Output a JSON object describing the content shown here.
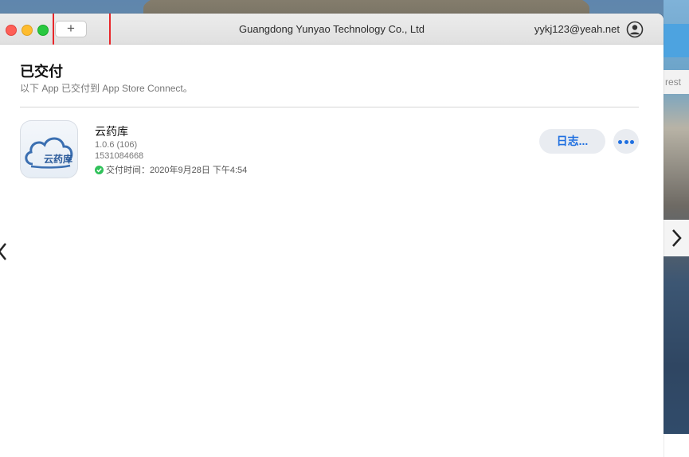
{
  "desktop": {
    "right_text": "rest"
  },
  "titlebar": {
    "add_label": "+",
    "team_name": "Guangdong Yunyao Technology Co., Ltd",
    "account": "yykj123@yeah.net"
  },
  "section": {
    "title": "已交付",
    "subtitle": "以下 App 已交付到 App Store Connect。"
  },
  "app": {
    "icon_text": "云药库",
    "name": "云药库",
    "version": "1.0.6 (106)",
    "id": "1531084668",
    "delivered": "交付时间：2020年9月28日 下午4:54",
    "log_label": "日志..."
  },
  "colors": {
    "accent": "#1f6fe0",
    "highlight": "#e8262a",
    "success": "#30c15a"
  },
  "icons": [
    "add-icon",
    "account-icon",
    "check-icon",
    "more-icon",
    "chevron-left-icon",
    "chevron-right-icon"
  ]
}
